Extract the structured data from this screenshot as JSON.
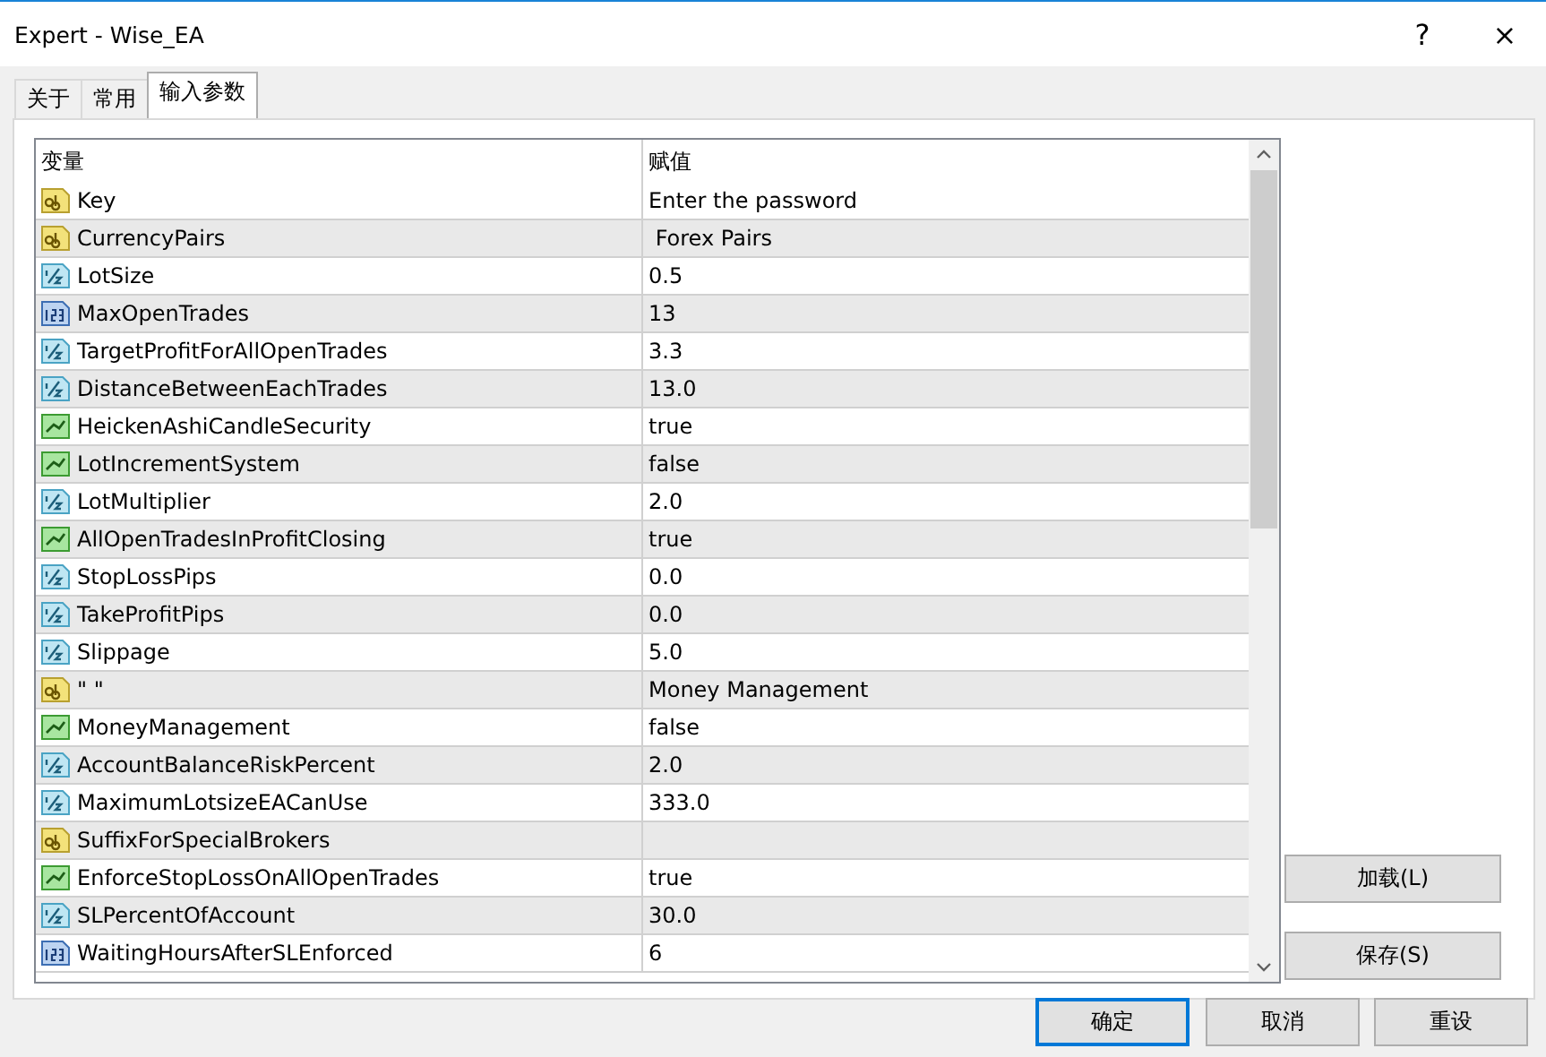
{
  "window": {
    "title": "Expert - Wise_EA",
    "help": "?",
    "close": "×"
  },
  "tabs": [
    {
      "label": "关于",
      "selected": false
    },
    {
      "label": "常用",
      "selected": false
    },
    {
      "label": "输入参数",
      "selected": true
    }
  ],
  "table": {
    "columns": [
      "变量",
      "赋值"
    ],
    "rows": [
      {
        "kind": "string",
        "name": "Key",
        "value": "Enter the password"
      },
      {
        "kind": "string",
        "name": "CurrencyPairs",
        "value": " Forex Pairs"
      },
      {
        "kind": "double",
        "name": "LotSize",
        "value": "0.5"
      },
      {
        "kind": "int",
        "name": "MaxOpenTrades",
        "value": "13"
      },
      {
        "kind": "double",
        "name": "TargetProfitForAllOpenTrades",
        "value": "3.3"
      },
      {
        "kind": "double",
        "name": "DistanceBetweenEachTrades",
        "value": "13.0"
      },
      {
        "kind": "bool",
        "name": "HeickenAshiCandleSecurity",
        "value": "true"
      },
      {
        "kind": "bool",
        "name": "LotIncrementSystem",
        "value": "false"
      },
      {
        "kind": "double",
        "name": "LotMultiplier",
        "value": "2.0"
      },
      {
        "kind": "bool",
        "name": "AllOpenTradesInProfitClosing",
        "value": "true"
      },
      {
        "kind": "double",
        "name": "StopLossPips",
        "value": "0.0"
      },
      {
        "kind": "double",
        "name": "TakeProfitPips",
        "value": "0.0"
      },
      {
        "kind": "double",
        "name": "Slippage",
        "value": "5.0"
      },
      {
        "kind": "string",
        "name": "\" \"",
        "value": "Money Management"
      },
      {
        "kind": "bool",
        "name": "MoneyManagement",
        "value": "false"
      },
      {
        "kind": "double",
        "name": "AccountBalanceRiskPercent",
        "value": "2.0"
      },
      {
        "kind": "double",
        "name": "MaximumLotsizeEACanUse",
        "value": "333.0"
      },
      {
        "kind": "string",
        "name": "SuffixForSpecialBrokers"
      },
      {
        "kind": "bool",
        "name": "EnforceStopLossOnAllOpenTrades",
        "value": "true"
      },
      {
        "kind": "double",
        "name": "SLPercentOfAccount",
        "value": "30.0"
      },
      {
        "kind": "int",
        "name": "WaitingHoursAfterSLEnforced",
        "value": "6"
      }
    ]
  },
  "side_buttons": [
    "加载(L)",
    "保存(S)"
  ],
  "buttons": [
    {
      "label": "确定",
      "selected": true
    },
    {
      "label": "取消",
      "selected": false
    },
    {
      "label": "重设",
      "selected": false
    }
  ]
}
